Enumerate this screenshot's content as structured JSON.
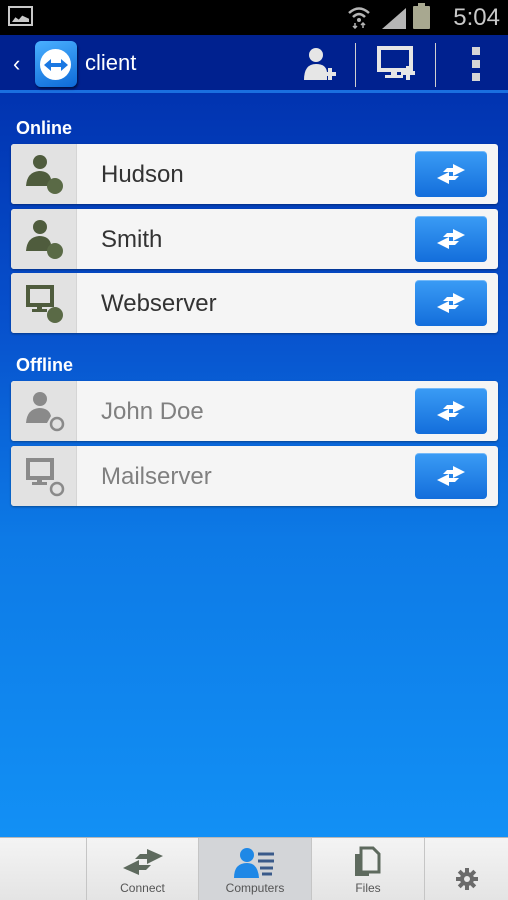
{
  "status_bar": {
    "time": "5:04",
    "icons": [
      "gallery-notification-icon",
      "wifi-icon",
      "signal-icon",
      "battery-icon"
    ]
  },
  "action_bar": {
    "back_glyph": "‹",
    "title": "client",
    "actions": [
      {
        "name": "add-contact",
        "icon": "add-user-icon"
      },
      {
        "name": "add-computer",
        "icon": "add-computer-icon"
      },
      {
        "name": "overflow-menu",
        "icon": "more-vert-icon"
      }
    ]
  },
  "colors": {
    "online_status": "#5a6a46",
    "offline_status": "#8a8a8a",
    "accent": "#1b78e2",
    "header": "#00218f"
  },
  "sections": [
    {
      "label": "Online",
      "items": [
        {
          "name": "Hudson",
          "type": "contact",
          "status": "online"
        },
        {
          "name": "Smith",
          "type": "contact",
          "status": "online"
        },
        {
          "name": "Webserver",
          "type": "computer",
          "status": "online"
        }
      ]
    },
    {
      "label": "Offline",
      "items": [
        {
          "name": "John Doe",
          "type": "contact",
          "status": "offline"
        },
        {
          "name": "Mailserver",
          "type": "computer",
          "status": "offline"
        }
      ]
    }
  ],
  "tabs": [
    {
      "label": "",
      "icon": ""
    },
    {
      "label": "Connect",
      "icon": "connect-arrows-icon"
    },
    {
      "label": "Computers",
      "icon": "computers-contacts-icon",
      "active": true
    },
    {
      "label": "Files",
      "icon": "files-icon"
    },
    {
      "label": "",
      "icon": "settings-gear-icon"
    }
  ]
}
